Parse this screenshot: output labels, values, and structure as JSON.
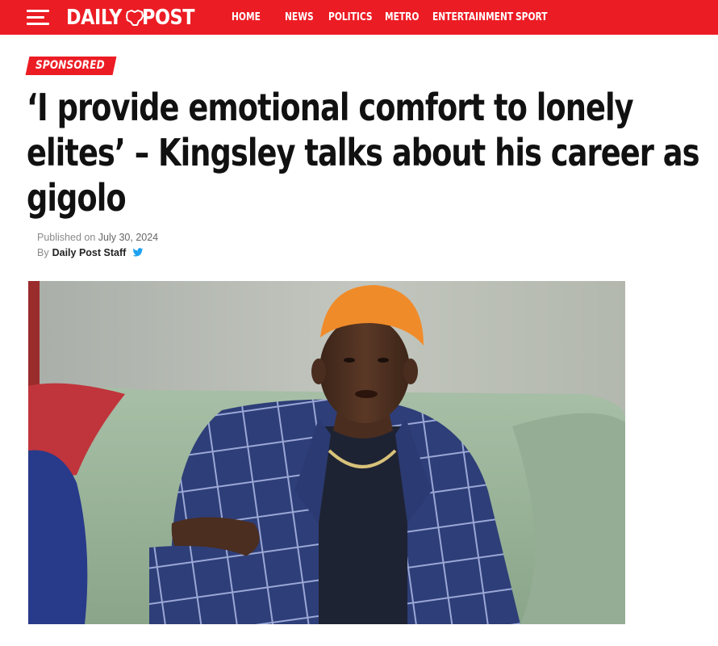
{
  "header": {
    "logo_left": "DAILY",
    "logo_right": "POST",
    "nav": [
      "HOME",
      "NEWS",
      "POLITICS",
      "METRO",
      "ENTERTAINMENT",
      "SPORT"
    ],
    "brand_color": "#ec1c24"
  },
  "article": {
    "tag": "SPONSORED",
    "headline": "‘I provide emotional comfort to lonely elites’ – Kingsley talks about his career as gigolo",
    "published_label": "Published on",
    "published_date": "July 30, 2024",
    "by_label": "By",
    "author": "Daily Post Staff",
    "share_icon": "twitter-icon"
  }
}
